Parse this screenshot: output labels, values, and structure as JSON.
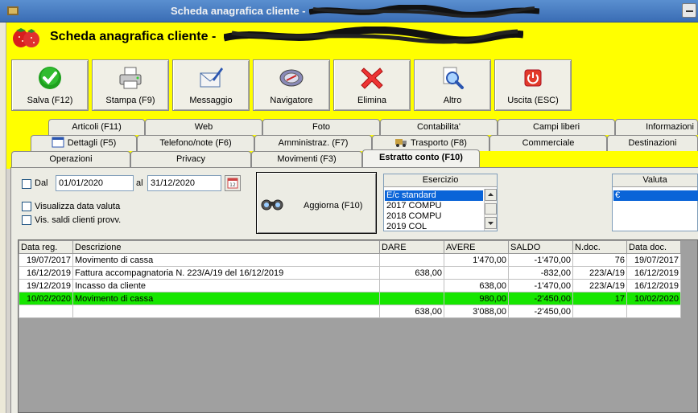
{
  "window": {
    "title": "Scheda anagrafica cliente - "
  },
  "header": {
    "title": "Scheda anagrafica cliente - "
  },
  "toolbar": {
    "salva": "Salva (F12)",
    "stampa": "Stampa (F9)",
    "messaggio": "Messaggio",
    "navigatore": "Navigatore",
    "elimina": "Elimina",
    "altro": "Altro",
    "uscita": "Uscita (ESC)"
  },
  "tabs": {
    "row1": [
      "Articoli (F11)",
      "Web",
      "Foto",
      "Contabilita'",
      "Campi liberi",
      "Informazioni"
    ],
    "row2": [
      "Dettagli (F5)",
      "Telefono/note (F6)",
      "Amministraz. (F7)",
      "Trasporto (F8)",
      "Commerciale",
      "Destinazioni"
    ],
    "row3": [
      "Operazioni",
      "Privacy",
      "Movimenti (F3)",
      "Estratto conto (F10)"
    ]
  },
  "filters": {
    "dal_label": "Dal",
    "date_from": "01/01/2020",
    "al_label": "al",
    "date_to": "31/12/2020",
    "visualizza_data_valuta": "Visualizza data valuta",
    "vis_saldi": "Vis. saldi clienti provv.",
    "aggiorna": "Aggiorna (F10)"
  },
  "esercizio": {
    "header": "Esercizio",
    "items": [
      "E/c standard",
      "2017 COMPU",
      "2018 COMPU",
      "2019 COL"
    ],
    "selected": "E/c standard"
  },
  "valuta": {
    "header": "Valuta",
    "items": [
      "€"
    ]
  },
  "grid": {
    "columns": [
      "Data reg.",
      "Descrizione",
      "DARE",
      "AVERE",
      "SALDO",
      "N.doc.",
      "Data doc."
    ],
    "rows": [
      [
        "19/07/2017",
        "Movimento di cassa",
        "",
        "1'470,00",
        "-1'470,00",
        "76",
        "19/07/2017"
      ],
      [
        "16/12/2019",
        "Fattura accompagnatoria N. 223/A/19 del 16/12/2019",
        "638,00",
        "",
        "-832,00",
        "223/A/19",
        "16/12/2019"
      ],
      [
        "19/12/2019",
        "Incasso da cliente",
        "",
        "638,00",
        "-1'470,00",
        "223/A/19",
        "16/12/2019"
      ],
      [
        "10/02/2020",
        "Movimento di cassa",
        "",
        "980,00",
        "-2'450,00",
        "17",
        "10/02/2020"
      ]
    ],
    "highlight_row": 3,
    "totals": [
      "",
      "",
      "638,00",
      "3'088,00",
      "-2'450,00",
      "",
      ""
    ],
    "highlight_color": "#16e600"
  },
  "colors": {
    "header_bg": "#ffff00",
    "titlebar": "#3a6db5",
    "selection": "#0a64d8"
  }
}
